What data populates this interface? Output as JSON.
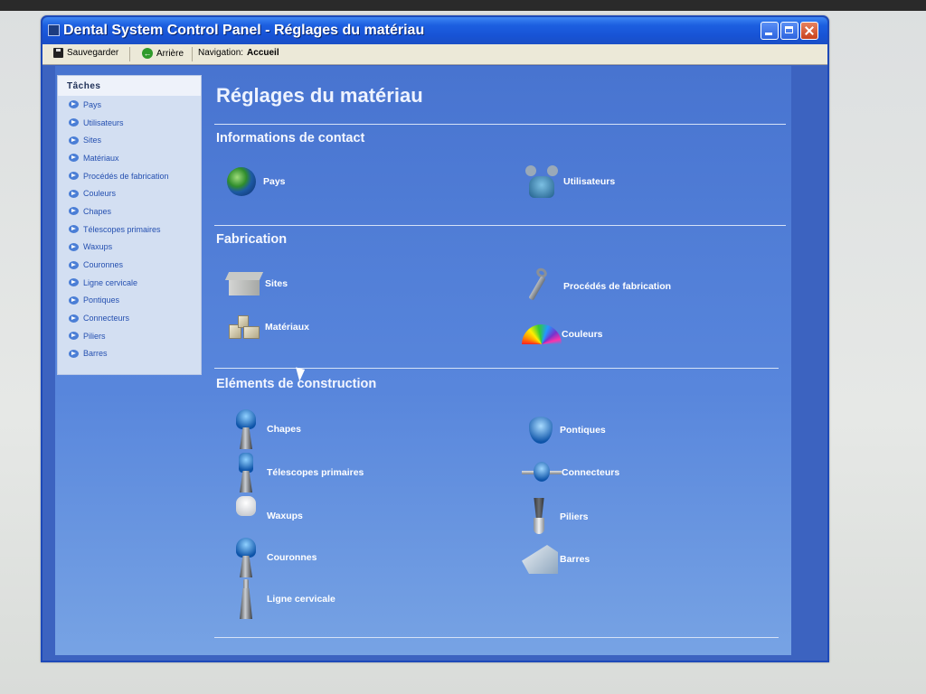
{
  "window": {
    "title": "Dental System Control Panel - Réglages du matériau"
  },
  "toolbar": {
    "save_label": "Sauvegarder",
    "back_label": "Arrière",
    "nav_label": "Navigation:",
    "nav_value": "Accueil"
  },
  "sidebar": {
    "header": "Tâches",
    "items": [
      {
        "label": "Pays"
      },
      {
        "label": "Utilisateurs"
      },
      {
        "label": "Sites"
      },
      {
        "label": "Matériaux"
      },
      {
        "label": "Procédés de fabrication"
      },
      {
        "label": "Couleurs"
      },
      {
        "label": "Chapes"
      },
      {
        "label": "Télescopes primaires"
      },
      {
        "label": "Waxups"
      },
      {
        "label": "Couronnes"
      },
      {
        "label": "Ligne cervicale"
      },
      {
        "label": "Pontiques"
      },
      {
        "label": "Connecteurs"
      },
      {
        "label": "Piliers"
      },
      {
        "label": "Barres"
      }
    ]
  },
  "main": {
    "title": "Réglages du matériau",
    "sections": {
      "contact": {
        "title": "Informations de contact",
        "items": {
          "pays": "Pays",
          "utilisateurs": "Utilisateurs"
        }
      },
      "fabrication": {
        "title": "Fabrication",
        "items": {
          "sites": "Sites",
          "procedes": "Procédés de fabrication",
          "materiaux": "Matériaux",
          "couleurs": "Couleurs"
        }
      },
      "elements": {
        "title": "Eléments de construction",
        "items": {
          "chapes": "Chapes",
          "telescopes": "Télescopes primaires",
          "waxups": "Waxups",
          "couronnes": "Couronnes",
          "ligne": "Ligne cervicale",
          "pontiques": "Pontiques",
          "connecteurs": "Connecteurs",
          "piliers": "Piliers",
          "barres": "Barres"
        }
      }
    }
  },
  "colors": {
    "titlebar": "#1753d5",
    "content_bg": "#4874d0",
    "sidebar_bg": "#d3dff2",
    "link": "#2550b0"
  }
}
